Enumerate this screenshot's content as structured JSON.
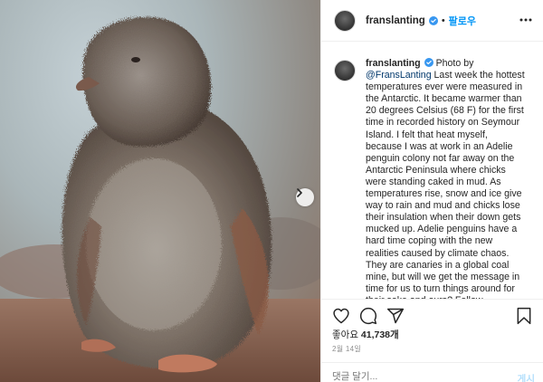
{
  "header": {
    "username": "franslanting",
    "separator": "•",
    "follow_label": "팔로우",
    "more_icon": "more-horizontal-icon"
  },
  "caption": {
    "username": "franslanting",
    "prefix": " Photo by ",
    "credit_link": "@FransLanting",
    "body": " Last week the hottest temperatures ever were measured in the Antarctic. It became warmer than 20 degrees Celsius (68 F) for the first time in recorded history on Seymour Island. I felt that heat myself, because I was at work in an Adelie penguin colony not far away on the Antarctic Peninsula where chicks were standing caked in mud. As temperatures rise, snow and ice give way to rain and mud and chicks lose their insulation when their down gets mucked up. Adelie penguins have a hard time coping with the new realities caused by climate chaos. They are canaries in a global coal mine, but will we get the message in time for us to turn things around for their sake and ours? Follow"
  },
  "actions": {
    "like_icon": "heart-icon",
    "comment_icon": "comment-icon",
    "share_icon": "share-icon",
    "save_icon": "bookmark-icon"
  },
  "likes": {
    "prefix": "좋아요 ",
    "count": "41,738개"
  },
  "date": "2월 14일",
  "comment": {
    "placeholder": "댓글 달기...",
    "post_label": "게시"
  },
  "colors": {
    "accent": "#0095f6",
    "link": "#00376b",
    "muted": "#8e8e8e",
    "post_disabled": "#b2dffc"
  }
}
